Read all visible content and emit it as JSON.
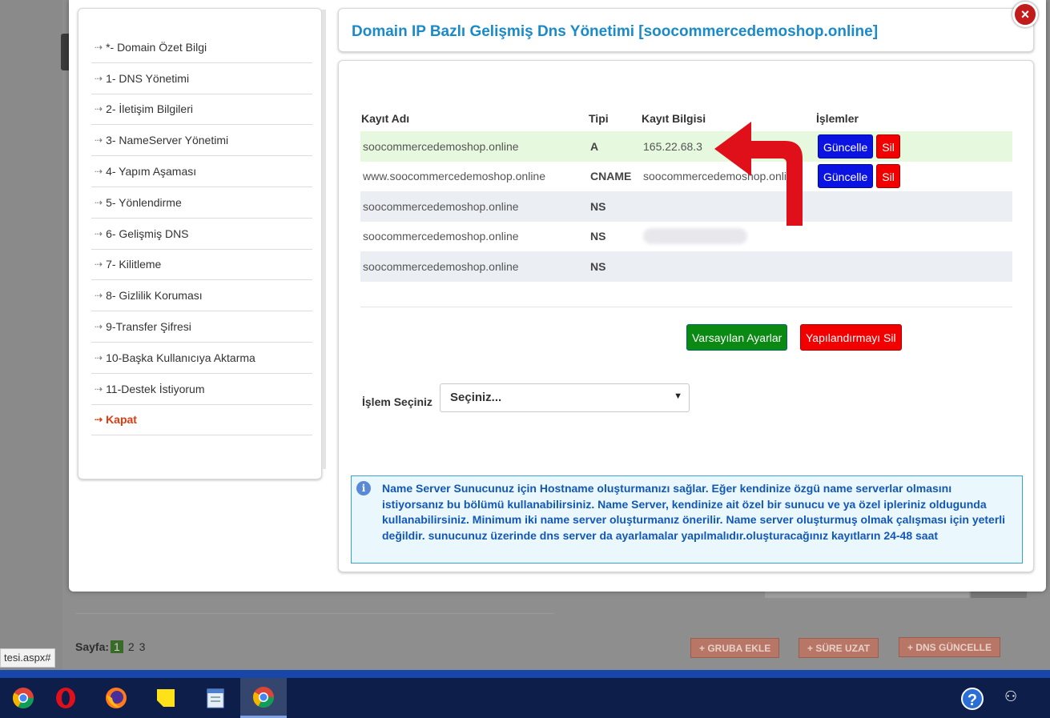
{
  "sidebar": {
    "items": [
      {
        "label": "*- Domain Özet Bilgi"
      },
      {
        "label": "1- DNS Yönetimi"
      },
      {
        "label": "2- İletişim Bilgileri"
      },
      {
        "label": "3- NameServer Yönetimi"
      },
      {
        "label": "4- Yapım Aşaması"
      },
      {
        "label": "5- Yönlendirme"
      },
      {
        "label": "6- Gelişmiş DNS"
      },
      {
        "label": "7- Kilitleme"
      },
      {
        "label": "8- Gizlilik Koruması"
      },
      {
        "label": "9-Transfer Şifresi"
      },
      {
        "label": "10-Başka Kullanıcıya Aktarma"
      },
      {
        "label": "11-Destek İstiyorum"
      },
      {
        "label": "Kapat"
      }
    ]
  },
  "modal": {
    "title": "Domain IP Bazlı Gelişmiş Dns Yönetimi [soocommercedemoshop.online]",
    "close_icon": "×"
  },
  "dns_table": {
    "headers": [
      "Kayıt Adı",
      "Tipi",
      "Kayıt Bilgisi",
      "İşlemler"
    ],
    "rows": [
      {
        "name": "soocommercedemoshop.online",
        "type": "A",
        "value": "165.22.68.3"
      },
      {
        "name": "www.soocommercedemoshop.online",
        "type": "CNAME",
        "value": "soocommercedemoshop.online"
      },
      {
        "name": "soocommercedemoshop.online",
        "type": "NS",
        "value": ""
      },
      {
        "name": "soocommercedemoshop.online",
        "type": "NS",
        "value": ""
      },
      {
        "name": "soocommercedemoshop.online",
        "type": "NS",
        "value": ""
      }
    ],
    "update_label": "Güncelle",
    "delete_label": "Sil"
  },
  "actions": {
    "default_settings": "Varsayılan Ayarlar",
    "delete_config": "Yapılandırmayı Sil"
  },
  "operation": {
    "label": "İşlem Seçiniz",
    "selected": "Seçiniz..."
  },
  "info": {
    "text": "Name Server Sunucunuz için Hostname oluşturmanızı sağlar. Eğer kendinize özgü name serverlar olmasını istiyorsanız bu bölümü kullanabilirsiniz. Name Server, kendinize ait özel bir sunucu ve ya özel ipleriniz oldugunda kullanabilirsiniz. Minimum iki name server oluşturmanız önerilir. Name server oluşturmuş olmak çalışması için yeterli değildir. sunucunuz üzerinde dns server da ayarlamalar yapılmalıdır.oluşturacağınız kayıtların 24-48 saat"
  },
  "background": {
    "pager_label": "Sayfa:",
    "pages": [
      "1",
      "2",
      "3"
    ],
    "buttons": [
      "+ GRUBA EKLE",
      "+ SÜRE UZAT",
      "+ DNS GÜNCELLE"
    ],
    "status_url": "tesi.aspx#"
  },
  "colors": {
    "title": "#1a8ac8",
    "update_button": "#0b13e3",
    "delete_button": "#f20000",
    "default_button": "#0a8a12",
    "kapat": "#e03a10"
  }
}
